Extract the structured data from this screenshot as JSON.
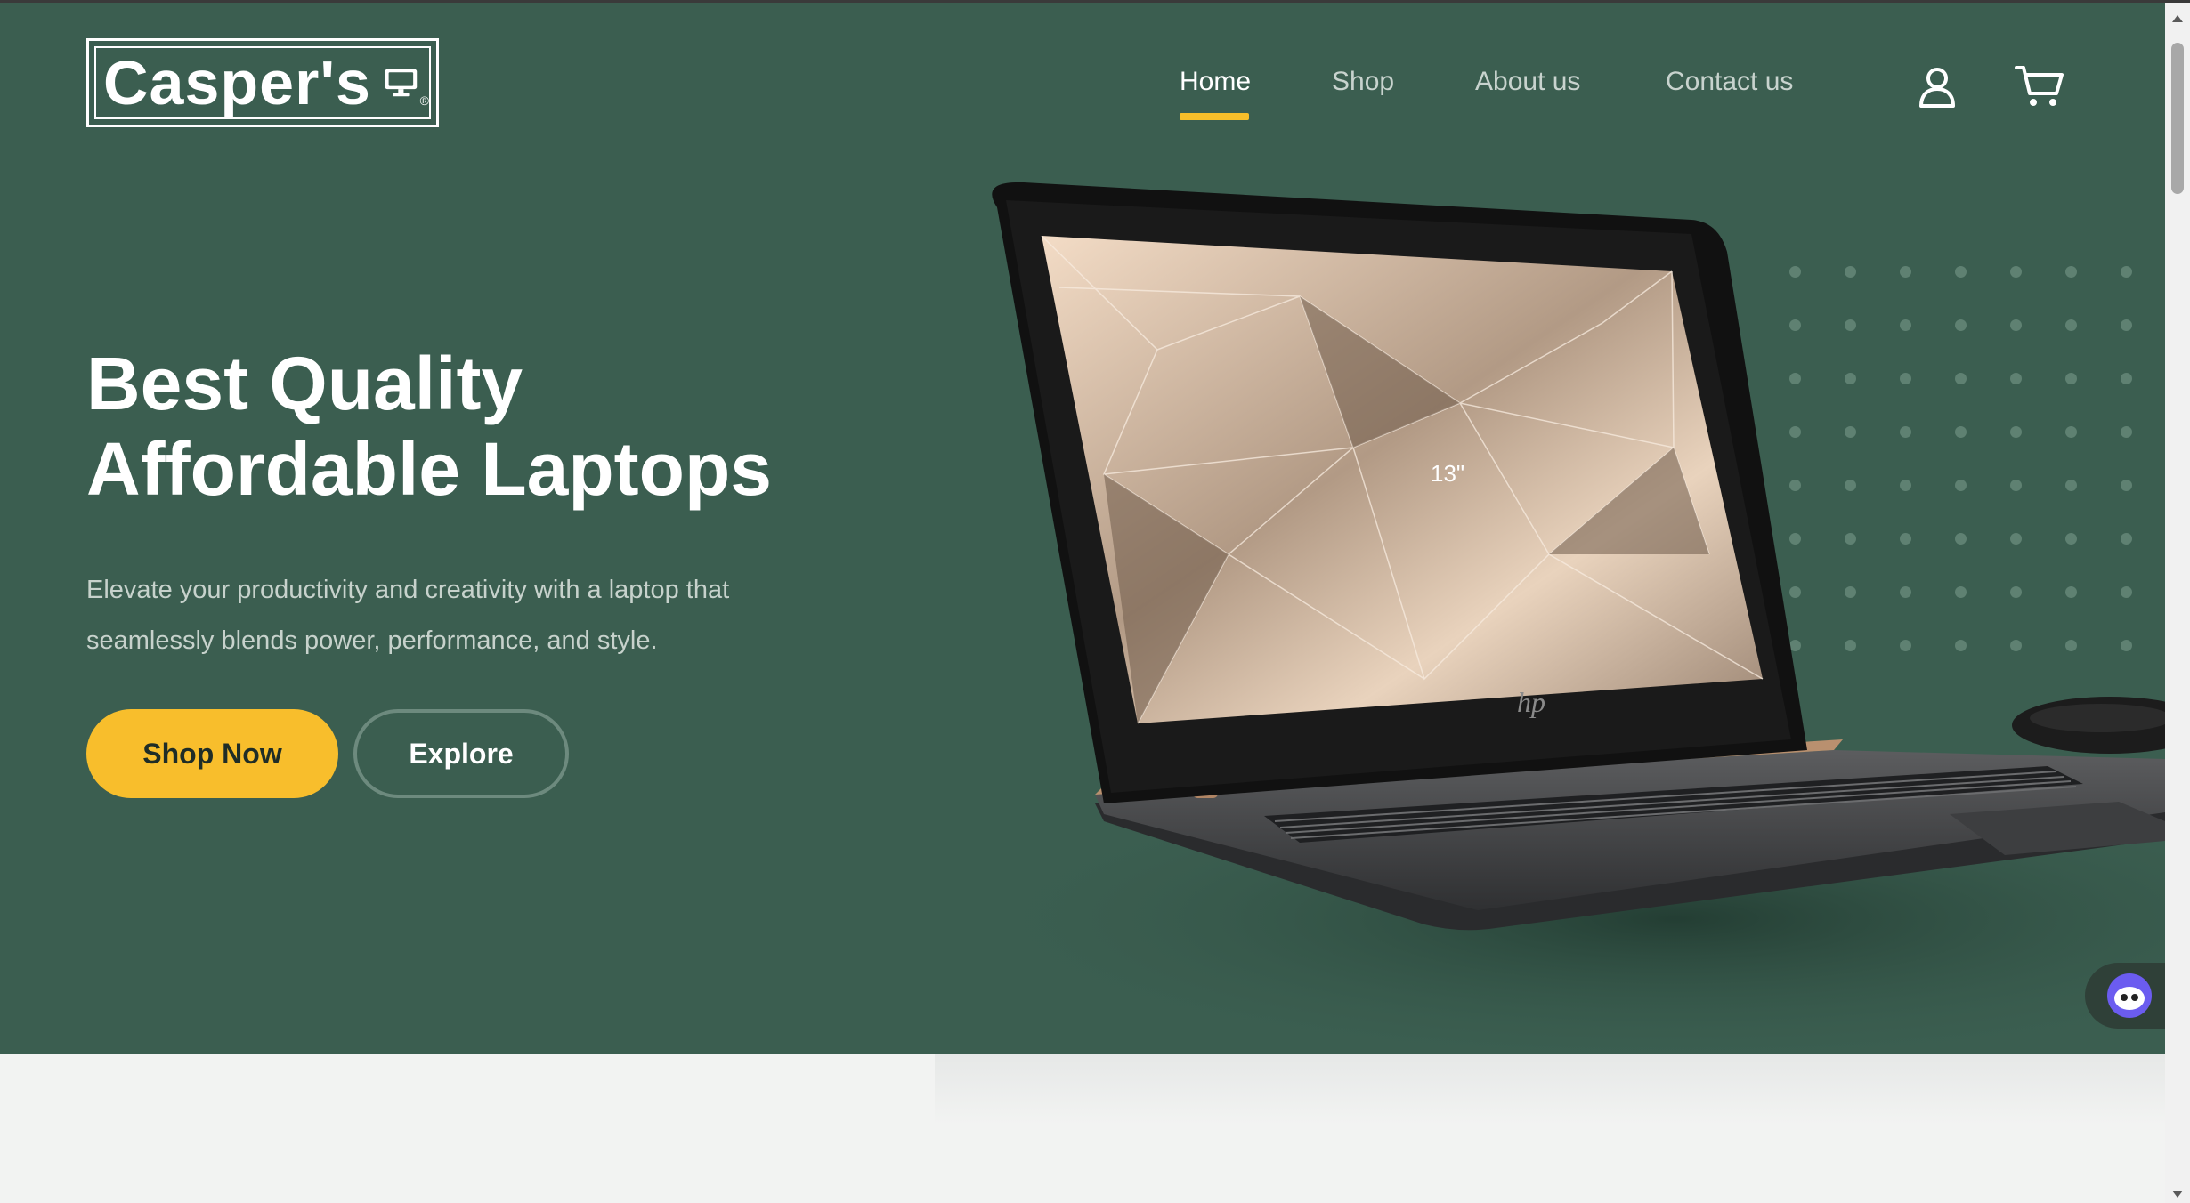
{
  "brand": {
    "name": "Casper's",
    "registered": "®"
  },
  "nav": {
    "items": [
      {
        "label": "Home",
        "active": true
      },
      {
        "label": "Shop",
        "active": false
      },
      {
        "label": "About us",
        "active": false
      },
      {
        "label": "Contact us",
        "active": false
      }
    ]
  },
  "header_icons": [
    "user-icon",
    "cart-icon"
  ],
  "hero": {
    "headline_line1": "Best Quality",
    "headline_line2": "Affordable Laptops",
    "subtext_line1": "Elevate your productivity and creativity with a laptop that",
    "subtext_line2": "seamlessly blends power, performance, and style.",
    "primary_button": "Shop Now",
    "secondary_button": "Explore",
    "screen_label": "13\""
  },
  "colors": {
    "hero_bg": "#3b5e50",
    "accent": "#f8be2c",
    "text_light": "#c7d2cc"
  }
}
